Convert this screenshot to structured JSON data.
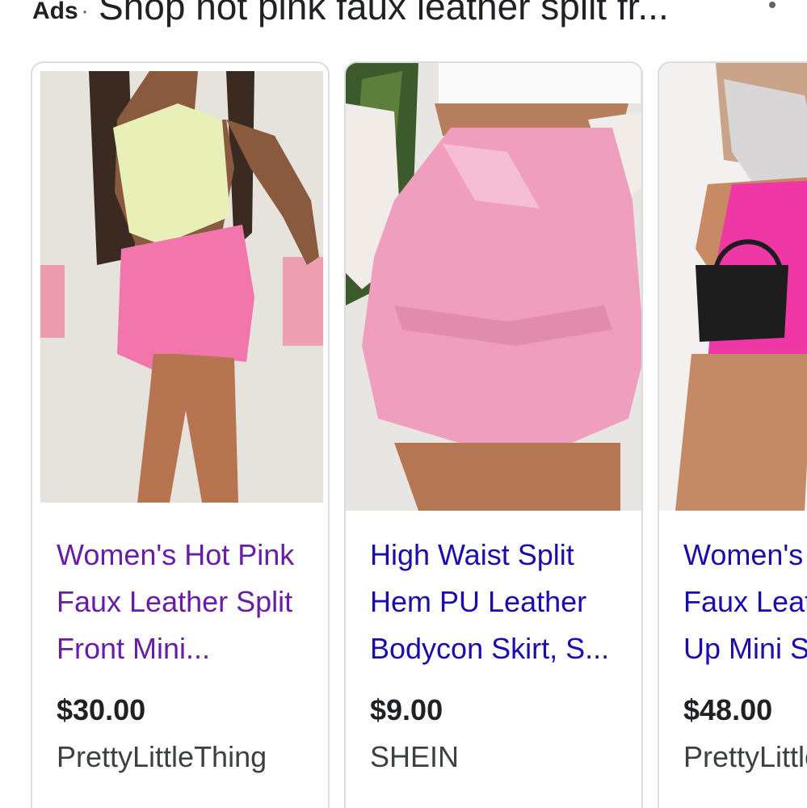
{
  "header": {
    "ads_label": "Ads",
    "separator": "·",
    "title": "Shop hot pink faux leather split fr...",
    "more_icon": "more-vert-icon"
  },
  "products": [
    {
      "title": "Women's Hot Pink Faux Leather Split Front Mini...",
      "price": "$30.00",
      "store": "PrettyLittleThing",
      "visited": true
    },
    {
      "title": "High Waist Split Hem PU Leather Bodycon Skirt, S...",
      "price": "$9.00",
      "store": "SHEIN",
      "visited": false
    },
    {
      "title": "Women's Hot Pink Faux Leather Lace Up Mini Skirt",
      "price": "$48.00",
      "store": "PrettyLittleThing",
      "visited": false
    }
  ],
  "colors": {
    "link": "#1a0dab",
    "visited_link": "#681da8",
    "card_border": "#dadce0"
  }
}
